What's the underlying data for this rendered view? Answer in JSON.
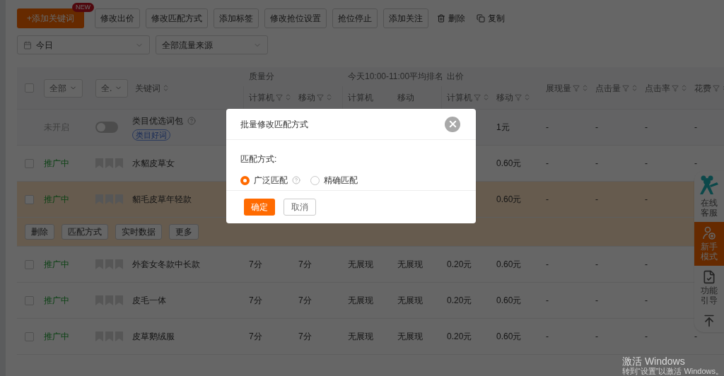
{
  "toolbar": {
    "add_button": {
      "label": "+添加关键词",
      "badge": "NEW"
    },
    "buttons": [
      "修改出价",
      "修改匹配方式",
      "添加标签",
      "修改抢位设置",
      "抢位停止",
      "添加关注"
    ],
    "actions": [
      {
        "kind": "delete",
        "label": "删除"
      },
      {
        "kind": "copy",
        "label": "复制"
      }
    ]
  },
  "filters": [
    {
      "kind": "date",
      "value": "今日"
    },
    {
      "kind": "select",
      "value": "全部流量来源"
    }
  ],
  "table": {
    "header_checked": false,
    "header_selects": [
      "全部",
      "全."
    ],
    "keyword_header": "关键词",
    "groups": [
      {
        "title": "质量分",
        "columns": [
          {
            "label": "计算机",
            "sortable": true
          },
          {
            "label": "移动",
            "sortable": true
          }
        ]
      },
      {
        "title": "今天10:00-11:00平均排名",
        "columns": [
          {
            "label": "计算机",
            "sortable": false
          },
          {
            "label": "移动",
            "sortable": false
          }
        ]
      },
      {
        "title": "出价",
        "columns": [
          {
            "label": "计算机",
            "sortable": true
          },
          {
            "label": "移动",
            "sortable": true
          }
        ]
      }
    ],
    "columns": [
      "展现量",
      "点击量",
      "点击率",
      "花费"
    ],
    "rows": [
      {
        "kind": "package",
        "selected": false,
        "status": {
          "label": "未开启",
          "active": false
        },
        "toggle_on": false,
        "name": "类目优选词包",
        "tag": "类目好词",
        "cells": [
          null,
          null,
          null,
          null,
          null,
          "1元",
          "-",
          "-",
          "-",
          "-"
        ]
      },
      {
        "kind": "keyword",
        "selected": false,
        "checked": false,
        "status": {
          "label": "推广中",
          "active": true
        },
        "keyword": "水貂皮草女",
        "cells": [
          null,
          null,
          null,
          null,
          null,
          "0.60元",
          "-",
          "-",
          "-",
          "-"
        ]
      },
      {
        "kind": "keyword",
        "selected": true,
        "checked": false,
        "status": {
          "label": "推广中",
          "active": true
        },
        "keyword": "貂毛皮草年轻款",
        "cells": [
          null,
          null,
          null,
          null,
          null,
          "0.60元",
          "-",
          "-",
          "-",
          null
        ]
      },
      {
        "kind": "actions",
        "buttons": [
          "删除",
          "匹配方式",
          "实时数据",
          "更多"
        ]
      },
      {
        "kind": "keyword",
        "selected": false,
        "checked": false,
        "status": {
          "label": "推广中",
          "active": true
        },
        "keyword": "外套女冬款中长款",
        "cells": [
          "7分",
          "7分",
          "无展现",
          "无展现",
          "0.20元",
          "0.60元",
          "-",
          "-",
          "-",
          null
        ]
      },
      {
        "kind": "keyword",
        "selected": false,
        "checked": false,
        "status": {
          "label": "推广中",
          "active": true
        },
        "keyword": "皮毛一体",
        "cells": [
          "7分",
          "7分",
          "无展现",
          "无展现",
          "0.20元",
          "0.60元",
          "-",
          "-",
          "-",
          null
        ]
      },
      {
        "kind": "keyword",
        "selected": false,
        "checked": false,
        "status": {
          "label": "推广中",
          "active": true
        },
        "keyword": "皮草鹅绒服",
        "cells": [
          "7分",
          "7分",
          "无展现",
          "无展现",
          "0.20元",
          "0.60元",
          "-",
          "-",
          "-",
          "-"
        ]
      }
    ]
  },
  "side_panel": [
    {
      "kind": "service",
      "label": "在线客服",
      "selected": false
    },
    {
      "kind": "novice",
      "label": "新手模式",
      "selected": true
    },
    {
      "kind": "guide",
      "label": "功能引导",
      "selected": false
    },
    {
      "kind": "top"
    }
  ],
  "dialog": {
    "title": "批量修改匹配方式",
    "field_label": "匹配方式:",
    "options": [
      {
        "label": "广泛匹配",
        "selected": true,
        "help": true
      },
      {
        "label": "精确匹配",
        "selected": false,
        "help": false
      }
    ],
    "confirm": "确定",
    "cancel": "取消"
  },
  "os_notice": {
    "title": "激活 Windows",
    "text": "转到“设置”以激活 Windows。"
  }
}
